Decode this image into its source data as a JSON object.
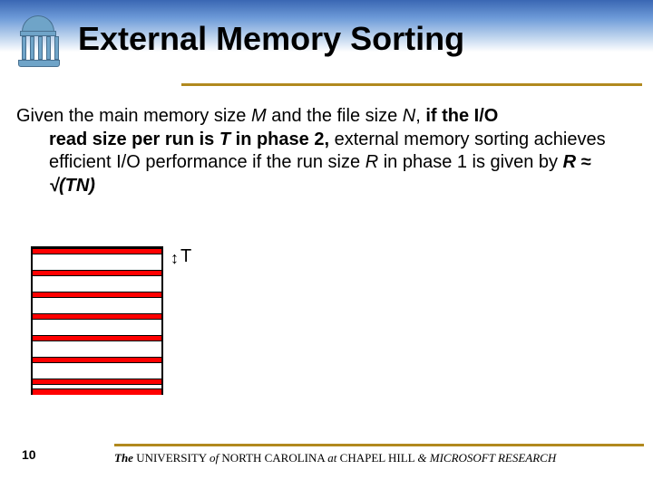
{
  "title": "External Memory Sorting",
  "body": {
    "line1_pre": "Given the main memory size ",
    "M": "M",
    "line1_mid": " and the file size ",
    "N": "N",
    "line1_post_comma": ", ",
    "bold1": "if the I/O",
    "bold2_indent": "read size per run is ",
    "T": "T",
    "bold2_post": " in phase 2,",
    "line2_rest": " external memory",
    "line3": "sorting achieves efficient I/O performance if the run size ",
    "R": "R",
    "line4_pre": "in phase 1 is given by ",
    "formula": "R ≈ √(TN)"
  },
  "t_label": "T",
  "page_number": "10",
  "footer": {
    "the": "The",
    "univ": " UNIVERSITY ",
    "of": "of",
    "nc": " NORTH CAROLINA ",
    "at": "at",
    "ch": " CHAPEL HILL ",
    "amp": "& MICROSOFT RESEARCH"
  }
}
